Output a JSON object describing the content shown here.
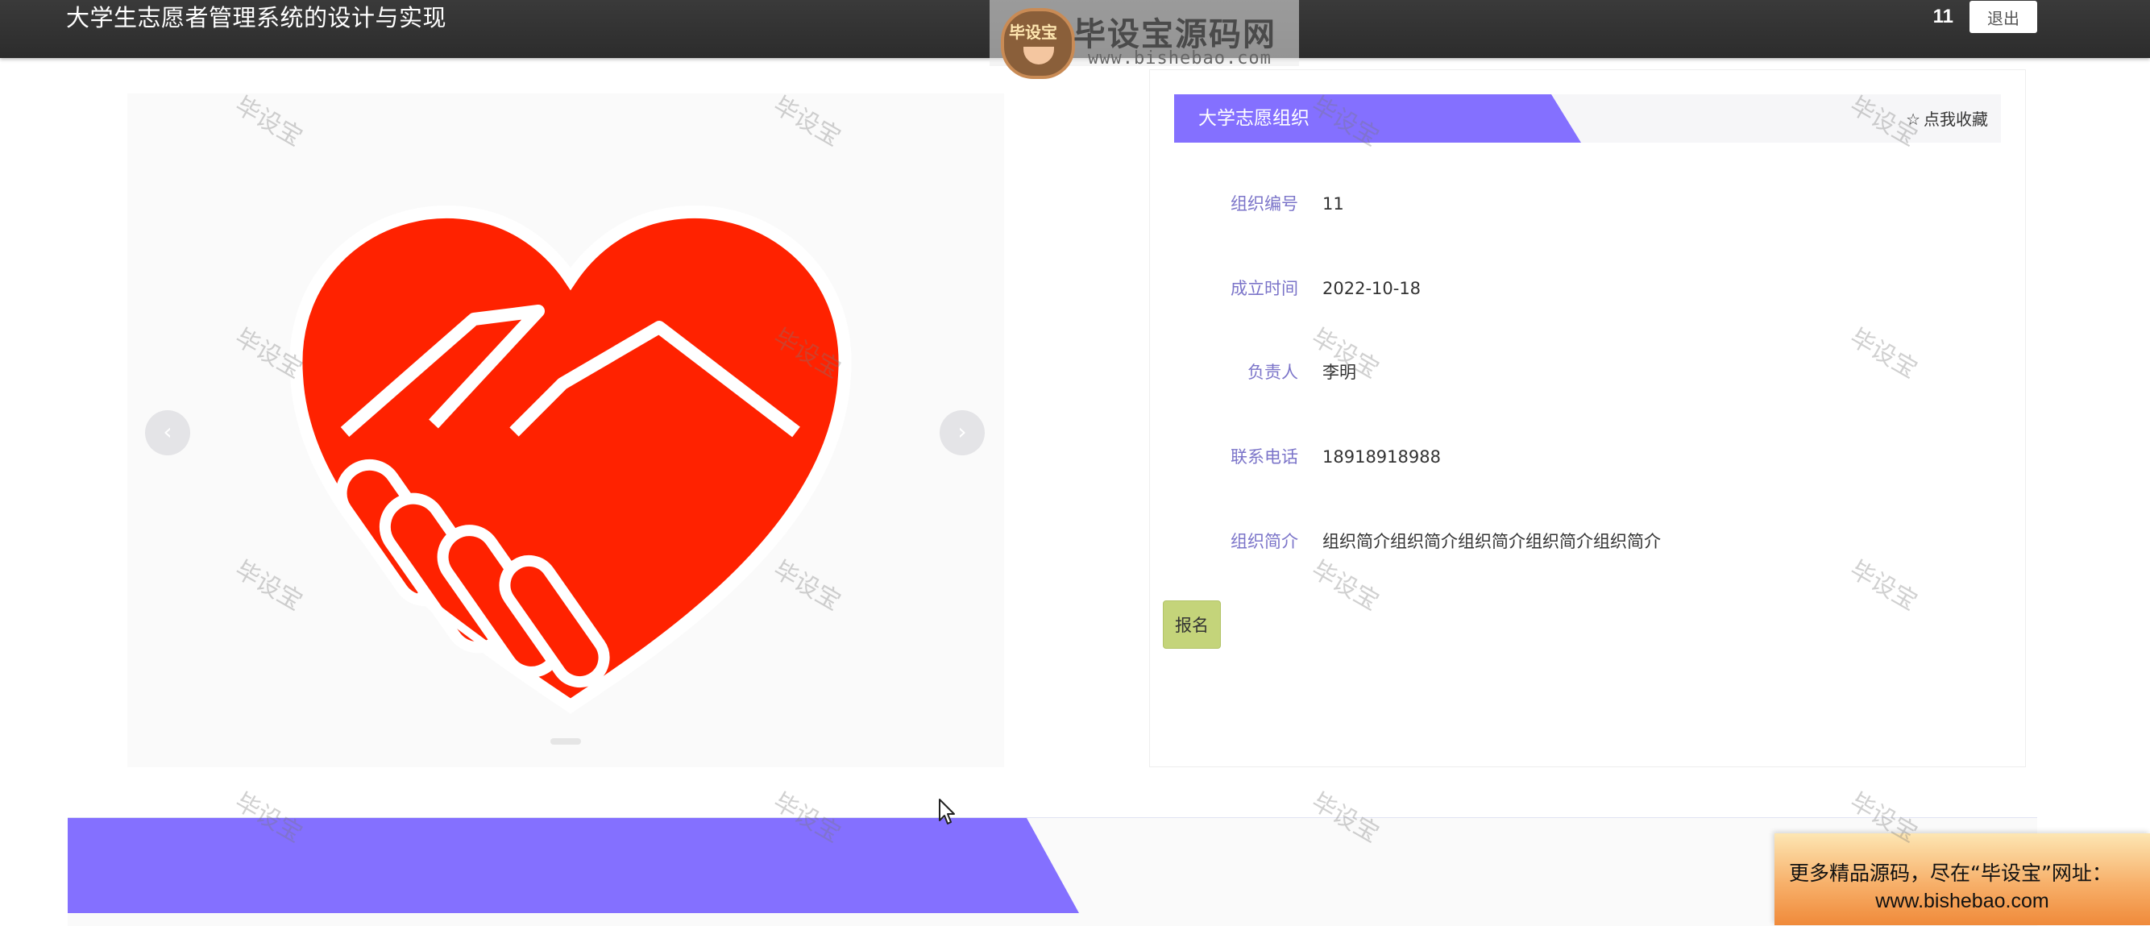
{
  "header": {
    "app_title": "大学生志愿者管理系统的设计与实现",
    "user_name": "11",
    "logout_label": "退出"
  },
  "watermark_logo": {
    "badge_text": "毕设宝",
    "brand": "毕设宝源码网",
    "url": "www.bishebao.com"
  },
  "carousel": {
    "prev_label": "‹",
    "next_label": "›",
    "image_icon": "heart-handshake-icon"
  },
  "detail": {
    "title": "大学志愿组织",
    "favorite_label": "点我收藏",
    "favorite_icon": "star-outline-icon",
    "fields": [
      {
        "label": "组织编号",
        "value": "11"
      },
      {
        "label": "成立时间",
        "value": "2022-10-18"
      },
      {
        "label": "负责人",
        "value": "李明"
      },
      {
        "label": "联系电话",
        "value": "18918918988"
      },
      {
        "label": "组织简介",
        "value": "组织简介组织简介组织简介组织简介组织简介"
      }
    ],
    "signup_label": "报名"
  },
  "ad": {
    "line1": "更多精品源码，尽在“毕设宝”网址：",
    "line2": "www.bishebao.com"
  },
  "watermark_text": "毕设宝",
  "colors": {
    "accent": "#8470ff",
    "header_bg": "#333333",
    "label": "#7b74c9",
    "signup_bg": "#c4d47a",
    "heart": "#ff2200"
  }
}
